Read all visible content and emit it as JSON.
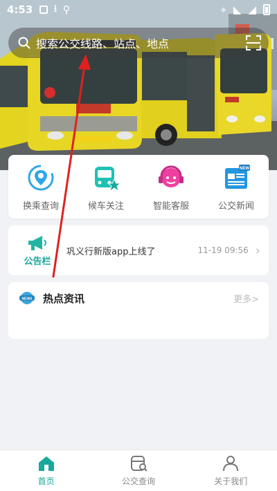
{
  "status_bar": {
    "time": "4:53"
  },
  "search": {
    "placeholder": "搜索公交线路、站点、地点"
  },
  "quick_menu": [
    {
      "label": "换乘查询",
      "icon": "location-pin-icon"
    },
    {
      "label": "候车关注",
      "icon": "bus-star-icon"
    },
    {
      "label": "智能客服",
      "icon": "headset-icon"
    },
    {
      "label": "公交新闻",
      "icon": "newspaper-icon"
    }
  ],
  "notice": {
    "label": "公告栏",
    "text": "巩义行新版app上线了",
    "time": "11-19 09:56"
  },
  "hot_news": {
    "title": "热点资讯",
    "more": "更多>"
  },
  "tabbar": [
    {
      "label": "首页",
      "active": true
    },
    {
      "label": "公交查询",
      "active": false
    },
    {
      "label": "关于我们",
      "active": false
    }
  ],
  "colors": {
    "accent": "#18a89c",
    "bus_yellow": "#e5d320",
    "annotation_red": "#e02020"
  }
}
